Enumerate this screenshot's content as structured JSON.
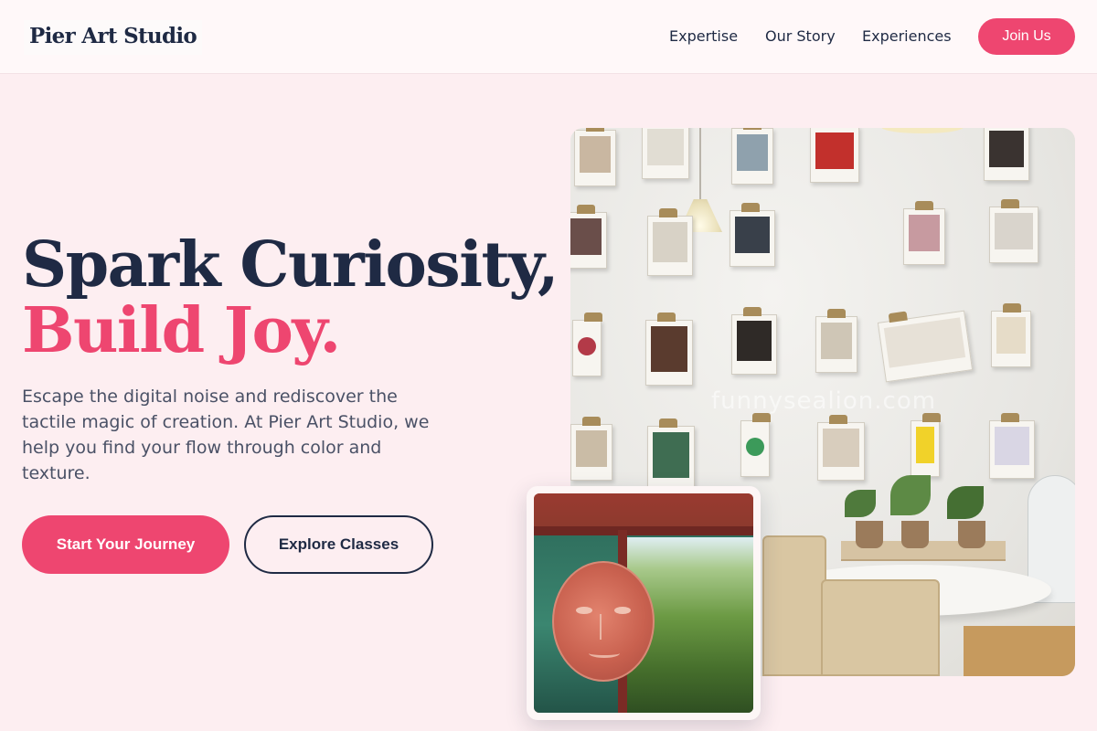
{
  "header": {
    "logo": "Pier Art Studio",
    "nav": [
      "Expertise",
      "Our Story",
      "Experiences"
    ],
    "cta": "Join Us"
  },
  "hero": {
    "headline_line1": "Spark Curiosity,",
    "headline_line2": "Build Joy.",
    "description": "Escape the digital noise and rediscover the tactile magic of creation. At Pier Art Studio, we help you find your flow through color and texture.",
    "primary_button": "Start Your Journey",
    "secondary_button": "Explore Classes"
  },
  "images": {
    "studio_watermark": "funnysealion.com"
  },
  "colors": {
    "accent": "#ee4670",
    "navy": "#1f2a44",
    "background": "#fdeef1"
  }
}
